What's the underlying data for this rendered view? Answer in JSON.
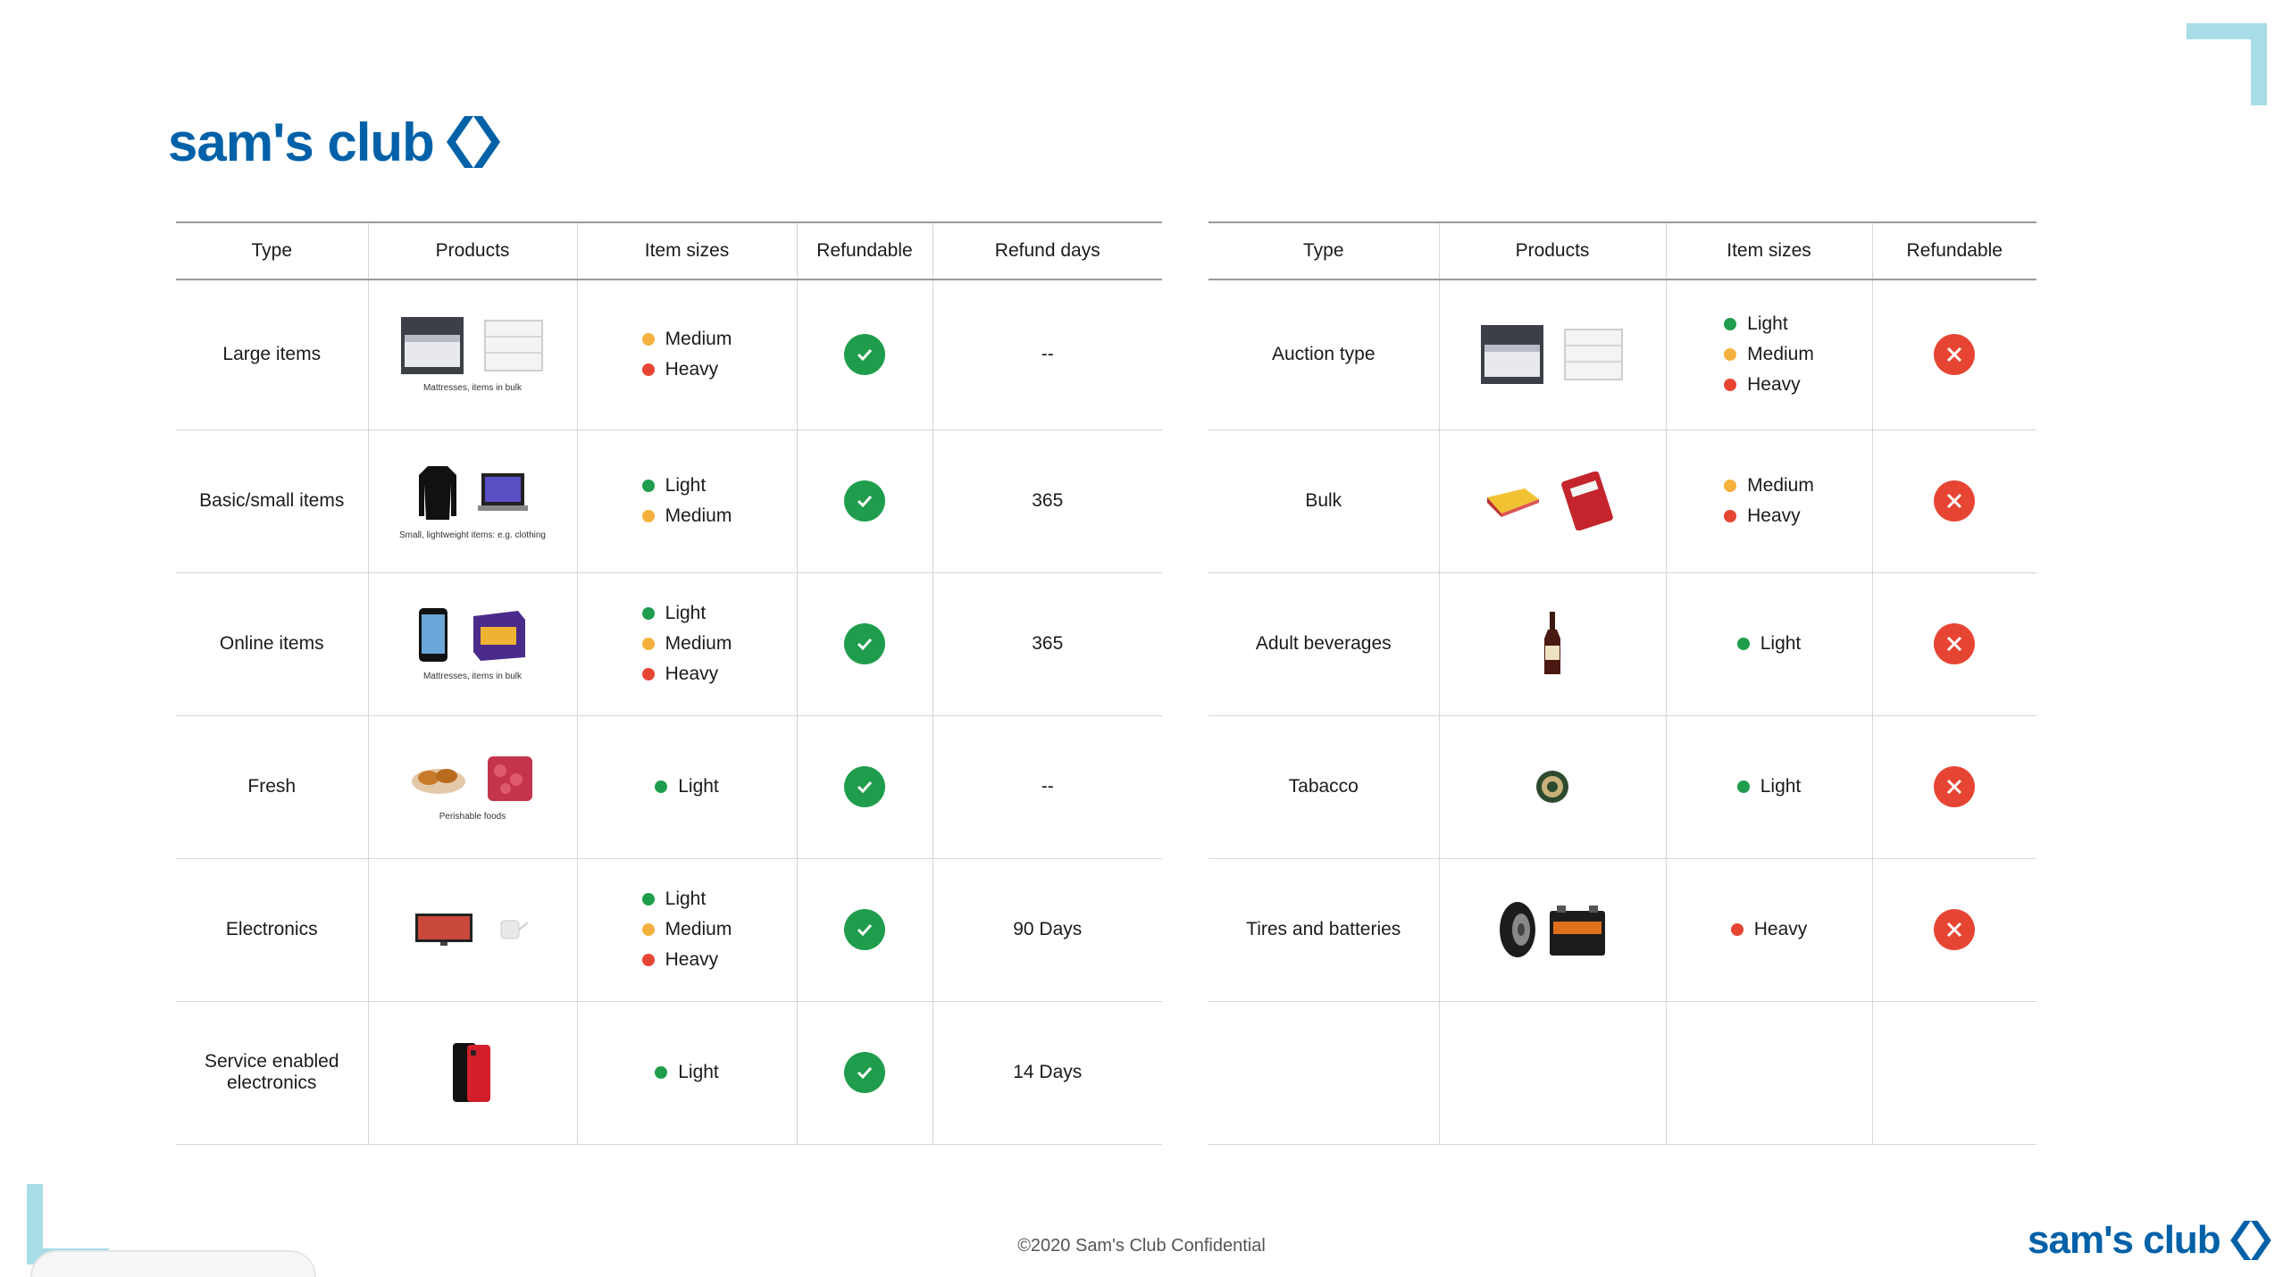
{
  "brand": {
    "name": "sam's club",
    "color": "#0061a8"
  },
  "footer": {
    "text": "©2020 Sam's Club Confidential"
  },
  "colors": {
    "light": "#1f9d4c",
    "medium": "#f4b13d",
    "heavy": "#e74533",
    "accent": "#a8dce7"
  },
  "table_left": {
    "headers": [
      "Type",
      "Products",
      "Item sizes",
      "Refundable",
      "Refund days"
    ],
    "rows": [
      {
        "type": "Large items",
        "caption": "Mattresses, items in bulk",
        "sizes": [
          "Medium",
          "Heavy"
        ],
        "refundable": true,
        "refund_days": "--"
      },
      {
        "type": "Basic/small items",
        "caption": "Small, lightweight items: e.g. clothing",
        "sizes": [
          "Light",
          "Medium"
        ],
        "refundable": true,
        "refund_days": "365"
      },
      {
        "type": "Online items",
        "caption": "Mattresses, items in bulk",
        "sizes": [
          "Light",
          "Medium",
          "Heavy"
        ],
        "refundable": true,
        "refund_days": "365"
      },
      {
        "type": "Fresh",
        "caption": "Perishable foods",
        "sizes": [
          "Light"
        ],
        "refundable": true,
        "refund_days": "--"
      },
      {
        "type": "Electronics",
        "caption": "",
        "sizes": [
          "Light",
          "Medium",
          "Heavy"
        ],
        "refundable": true,
        "refund_days": "90 Days"
      },
      {
        "type": "Service enabled electronics",
        "caption": "",
        "sizes": [
          "Light"
        ],
        "refundable": true,
        "refund_days": "14 Days"
      }
    ]
  },
  "table_right": {
    "headers": [
      "Type",
      "Products",
      "Item sizes",
      "Refundable"
    ],
    "rows": [
      {
        "type": "Auction type",
        "sizes": [
          "Light",
          "Medium",
          "Heavy"
        ],
        "refundable": false
      },
      {
        "type": "Bulk",
        "sizes": [
          "Medium",
          "Heavy"
        ],
        "refundable": false
      },
      {
        "type": "Adult beverages",
        "sizes": [
          "Light"
        ],
        "refundable": false
      },
      {
        "type": "Tabacco",
        "sizes": [
          "Light"
        ],
        "refundable": false
      },
      {
        "type": "Tires and batteries",
        "sizes": [
          "Heavy"
        ],
        "refundable": false
      },
      {
        "type": "",
        "sizes": [],
        "refundable": null
      }
    ]
  }
}
